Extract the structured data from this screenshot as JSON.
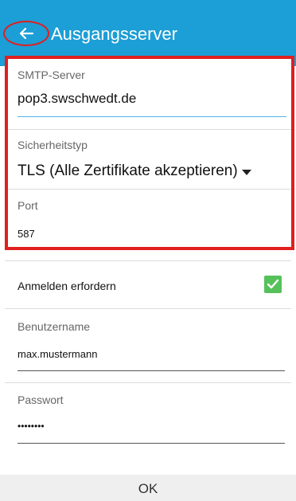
{
  "header": {
    "title": "Ausgangsserver",
    "back_icon": "arrow-left-icon",
    "bar_color": "#1c9ed6"
  },
  "server": {
    "smtp_label": "SMTP-Server",
    "smtp_value": "pop3.swschwedt.de",
    "security_label": "Sicherheitstyp",
    "security_value": "TLS (Alle Zertifikate akzeptieren)",
    "port_label": "Port",
    "port_value": "587"
  },
  "auth": {
    "require_label": "Anmelden erfordern",
    "require_checked": true,
    "username_label": "Benutzername",
    "username_value": "max.mustermann",
    "password_label": "Passwort",
    "password_value": "••••••••"
  },
  "footer": {
    "ok_label": "OK"
  }
}
